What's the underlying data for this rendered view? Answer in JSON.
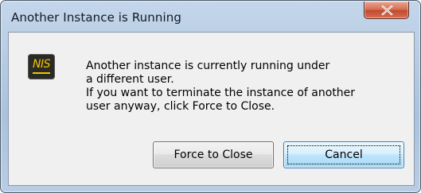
{
  "window": {
    "title": "Another Instance is Running"
  },
  "titlebar": {
    "close_icon": "close-x-icon"
  },
  "icon": {
    "name": "nis-app-icon",
    "text": "NIS",
    "color": "#f5c400"
  },
  "message": {
    "lines": [
      "Another instance is currently running under",
      "a different user.",
      "If you want to terminate the instance of another",
      "user anyway, click Force to Close."
    ]
  },
  "buttons": {
    "force_close": "Force to Close",
    "cancel": "Cancel"
  },
  "colors": {
    "titlebar": "#b7cce3",
    "close_button": "#c24a2e",
    "dialog_background": "#f0f0f0",
    "default_button_border": "#3c7fb1"
  }
}
